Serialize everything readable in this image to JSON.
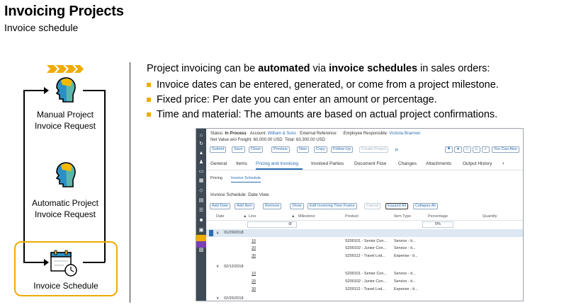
{
  "slide": {
    "title": "Invoicing Projects",
    "subtitle": "Invoice schedule"
  },
  "flow": {
    "items": [
      {
        "label_line1": "Manual Project",
        "label_line2": "Invoice Request"
      },
      {
        "label_line1": "Automatic Project",
        "label_line2": "Invoice Request"
      },
      {
        "label_line1": "Invoice Schedule",
        "label_line2": ""
      }
    ],
    "colors": {
      "accent": "#f0ab00",
      "person_blue": "#2a8fc4",
      "person_teal": "#5bb6ad",
      "person_yellow": "#f5b800"
    }
  },
  "content": {
    "intro_pre": "Project invoicing can be ",
    "intro_bold1": "automated",
    "intro_mid": " via ",
    "intro_bold2": "invoice schedules",
    "intro_post": " in sales orders:",
    "bullets": [
      "Invoice dates can be entered, generated, or come from a project milestone.",
      "Fixed price: Per date you can enter an amount or percentage.",
      "Time and material: The amounts are based on actual project confirmations."
    ]
  },
  "app": {
    "header": {
      "status_label": "Status:",
      "status_value": "In Process",
      "account_label": "Account:",
      "account_value": "William & Sons",
      "extref_label": "External Reference:",
      "emp_label": "Employee Responsible:",
      "emp_value": "Victoria Brannon",
      "net_value": "Net Value w/o Freight: 60,000.00 USD",
      "total": "Total: 63,300.00 USD"
    },
    "toolbar": [
      "Submit",
      "Save",
      "Close",
      "Preview",
      "New",
      "Copy",
      "Follow-Up",
      "Create Project"
    ],
    "toolbar_more": "»",
    "you_can_also": "You Can Also",
    "tabs": [
      "General",
      "Items",
      "Pricing and Invoicing",
      "Involved Parties",
      "Document Flow",
      "Changes",
      "Attachments",
      "Output History"
    ],
    "tabs_more": "›",
    "subtabs": [
      "Pricing",
      "Invoice Schedule"
    ],
    "section_title": "Invoice Schedule: Date View",
    "actions": [
      "Add Date",
      "Add Item",
      "Remove",
      "Show",
      "Edit Invoicing Time Frame",
      "Cancel",
      "Expand All",
      "Collapse All"
    ],
    "columns": [
      "Date",
      "Line",
      "Milestone",
      "Product",
      "Item Type",
      "Percentage",
      "Quantity"
    ],
    "filter_percentage": "0%",
    "groups": [
      {
        "date": "01/29/2018",
        "rows": [
          {
            "line": "10",
            "product": "S200101 - Senior Con...",
            "type": "Service - ti..."
          },
          {
            "line": "20",
            "product": "S200102 - Junior Con...",
            "type": "Service - ti..."
          },
          {
            "line": "30",
            "product": "S200112 - Travel Lod...",
            "type": "Expense - ti..."
          }
        ]
      },
      {
        "date": "02/12/2018",
        "rows": [
          {
            "line": "10",
            "product": "S200101 - Senior Con...",
            "type": "Service - ti..."
          },
          {
            "line": "20",
            "product": "S200102 - Junior Con...",
            "type": "Service - ti..."
          },
          {
            "line": "30",
            "product": "S200112 - Travel Lod...",
            "type": "Expense - ti..."
          }
        ]
      },
      {
        "date": "02/26/2018",
        "rows": []
      }
    ]
  }
}
